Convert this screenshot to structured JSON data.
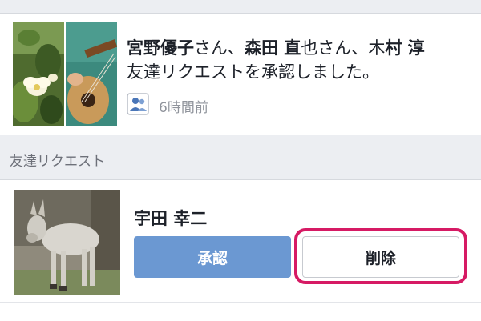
{
  "notification": {
    "name1": "宮野優子",
    "suffix1": "さん、",
    "name2": "森田 直",
    "name2_rest": "也さん、",
    "name3a": "木",
    "name3b": "村 淳",
    "line2": "友達リクエストを承認しました。",
    "time": "6時間前",
    "icon": "friends-icon"
  },
  "section": {
    "title": "友達リクエスト"
  },
  "request": {
    "name": "宇田 幸二",
    "confirm_label": "承認",
    "delete_label": "削除"
  },
  "colors": {
    "confirm_bg": "#6b98d2",
    "highlight": "#d61a64",
    "icon_blue": "#4a76b8"
  }
}
